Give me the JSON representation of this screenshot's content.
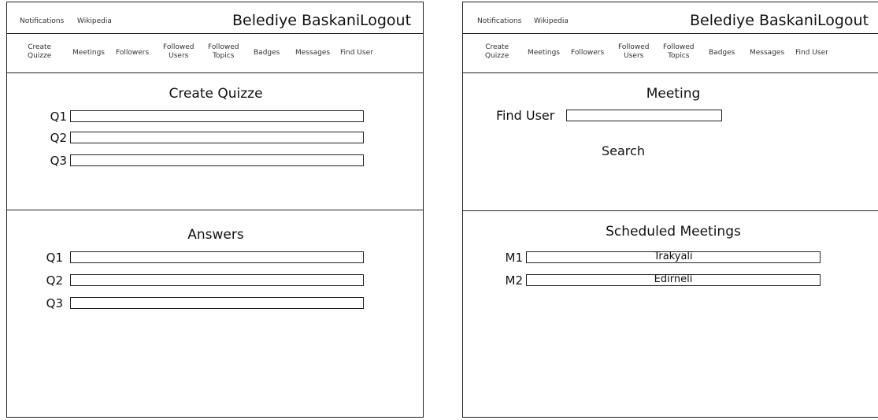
{
  "header": {
    "notifications_label": "Notifications",
    "wikipedia_label": "Wikipedia",
    "user_label": "Belediye Baskani",
    "logout_label": "Logout"
  },
  "nav": {
    "create_quizze": "Create\nQuizze",
    "meetings": "Meetings",
    "followers": "Followers",
    "followed_users": "Followed\nUsers",
    "followed_topics": "Followed\nTopics",
    "badges": "Badges",
    "messages": "Messages",
    "find_user": "Find User"
  },
  "quiz_page": {
    "create_title": "Create Quizze",
    "answers_title": "Answers",
    "question_labels": [
      "Q1",
      "Q2",
      "Q3"
    ],
    "answer_labels": [
      "Q1",
      "Q2",
      "Q3"
    ]
  },
  "meeting_page": {
    "meeting_title": "Meeting",
    "find_user_label": "Find User",
    "search_label": "Search",
    "scheduled_title": "Scheduled Meetings",
    "meetings": [
      {
        "label": "M1",
        "value": "Trakyali"
      },
      {
        "label": "M2",
        "value": "Edirneli"
      }
    ]
  }
}
